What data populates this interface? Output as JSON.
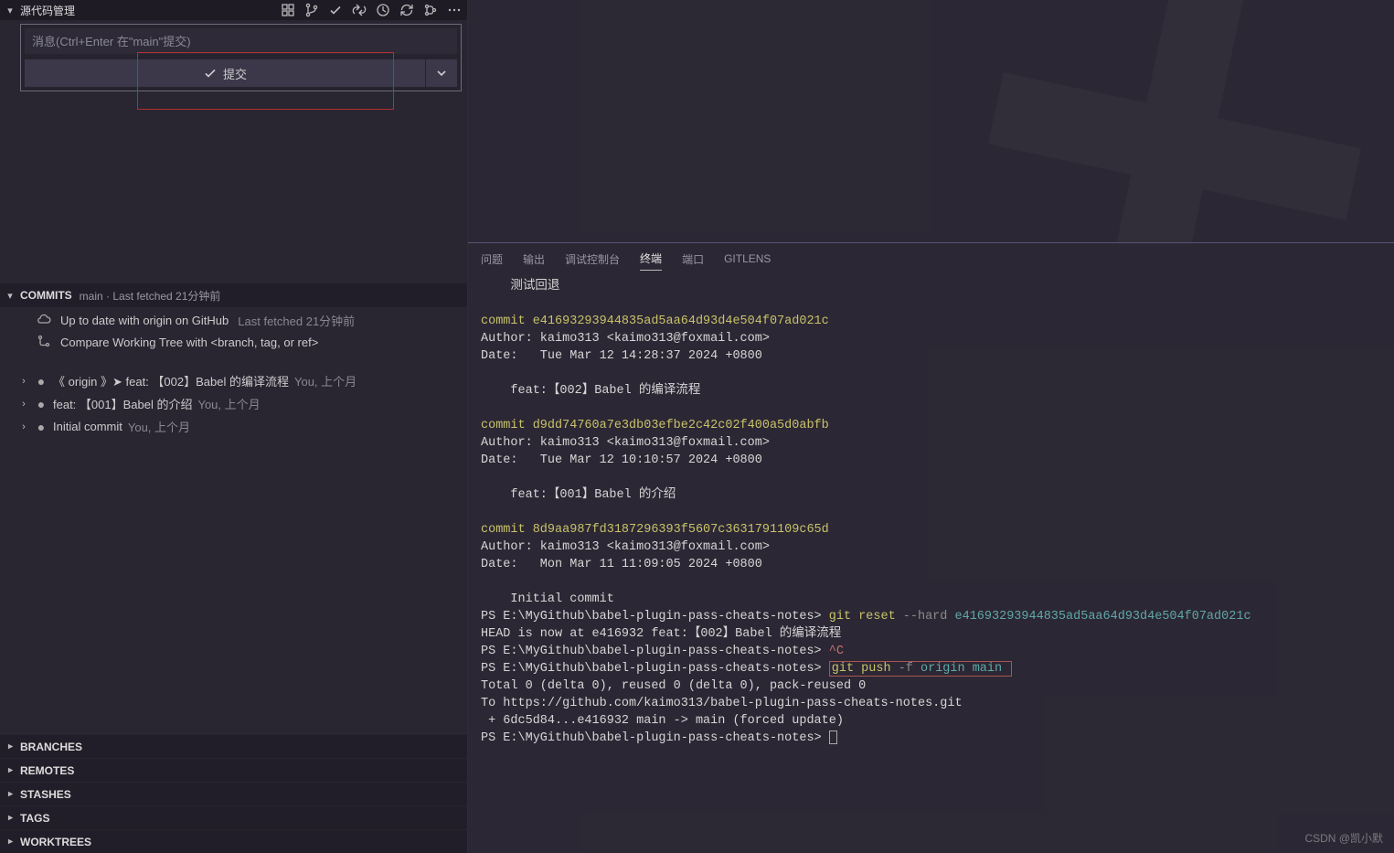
{
  "sidebar": {
    "title": "源代码管理",
    "toolbar_icons": [
      "view-tree-icon",
      "branch-icon",
      "check-icon",
      "sync-arrows-icon",
      "refresh-icon",
      "undo-icon",
      "rebase-icon",
      "more-icon"
    ],
    "commit_input_placeholder": "消息(Ctrl+Enter 在\"main\"提交)",
    "commit_button_label": "提交"
  },
  "commits_section": {
    "title": "COMMITS",
    "meta": " main · Last fetched 21分钟前",
    "sync_row": {
      "text": "Up to date with origin on GitHub",
      "meta": "Last fetched 21分钟前"
    },
    "compare_row": {
      "text": "Compare Working Tree with <branch, tag, or ref>"
    },
    "items": [
      {
        "msg": "《 origin 》➤  feat: 【002】Babel 的编译流程",
        "who": "You, 上个月"
      },
      {
        "msg": "feat: 【001】Babel 的介绍",
        "who": "You, 上个月"
      },
      {
        "msg": "Initial commit",
        "who": "You, 上个月"
      }
    ]
  },
  "bottom_sections": [
    {
      "title": "BRANCHES"
    },
    {
      "title": "REMOTES"
    },
    {
      "title": "STASHES"
    },
    {
      "title": "TAGS"
    },
    {
      "title": "WORKTREES"
    }
  ],
  "terminal_tabs": [
    {
      "label": "问题",
      "active": false
    },
    {
      "label": "输出",
      "active": false
    },
    {
      "label": "调试控制台",
      "active": false
    },
    {
      "label": "终端",
      "active": true
    },
    {
      "label": "端口",
      "active": false
    },
    {
      "label": "GITLENS",
      "active": false
    }
  ],
  "terminal": {
    "l0": "    测试回退",
    "l1": "commit e41693293944835ad5aa64d93d4e504f07ad021c",
    "l2": "Author: kaimo313 <kaimo313@foxmail.com>",
    "l3": "Date:   Tue Mar 12 14:28:37 2024 +0800",
    "l4": "    feat:【002】Babel 的编译流程",
    "l5": "commit d9dd74760a7e3db03efbe2c42c02f400a5d0abfb",
    "l6": "Author: kaimo313 <kaimo313@foxmail.com>",
    "l7": "Date:   Tue Mar 12 10:10:57 2024 +0800",
    "l8": "    feat:【001】Babel 的介绍",
    "l9": "commit 8d9aa987fd3187296393f5607c3631791109c65d",
    "l10": "Author: kaimo313 <kaimo313@foxmail.com>",
    "l11": "Date:   Mon Mar 11 11:09:05 2024 +0800",
    "l12": "    Initial commit",
    "p1_path": "PS E:\\MyGithub\\babel-plugin-pass-cheats-notes> ",
    "p1_cmd_a": "git reset ",
    "p1_cmd_b": "--hard",
    "p1_cmd_c": " e41693293944835ad5aa64d93d4e504f07ad021c",
    "head_now": "HEAD is now at e416932 feat:【002】Babel 的编译流程",
    "p2_path": "PS E:\\MyGithub\\babel-plugin-pass-cheats-notes> ",
    "p2_cmd": "^C",
    "p3_path": "PS E:\\MyGithub\\babel-plugin-pass-cheats-notes> ",
    "p3_cmd_a": "git push ",
    "p3_cmd_b": "-f",
    "p3_cmd_c": " origin main",
    "total": "Total 0 (delta 0), reused 0 (delta 0), pack-reused 0",
    "to_line": "To https://github.com/kaimo313/babel-plugin-pass-cheats-notes.git",
    "forced": " + 6dc5d84...e416932 main -> main (forced update)",
    "p4_path": "PS E:\\MyGithub\\babel-plugin-pass-cheats-notes> "
  },
  "watermark": "CSDN @凯小默"
}
